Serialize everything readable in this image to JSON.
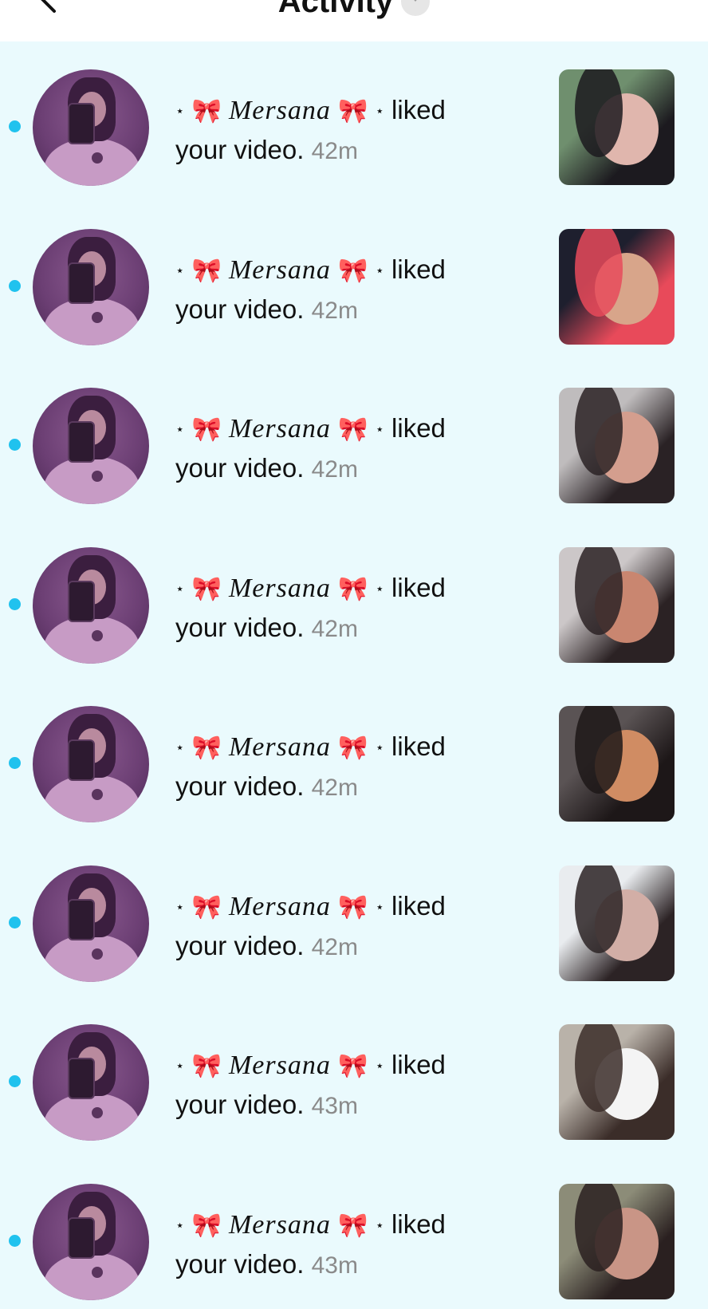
{
  "header": {
    "title": "Activity"
  },
  "colors": {
    "background": "#eafafd",
    "header": "#ffffff",
    "unread_dot": "#20c2ee",
    "timestamp": "#8a8a8a"
  },
  "notifications": [
    {
      "star_left": "⋆",
      "bow_left": "🎀",
      "username": "Mersana",
      "bow_right": "🎀",
      "star_right": "⋆",
      "action": "liked",
      "object": "your video.",
      "time": "42m",
      "unread": true,
      "thumb_colors": [
        "#6f8f6e",
        "#1c1a1f",
        "#e0b6ad"
      ]
    },
    {
      "star_left": "⋆",
      "bow_left": "🎀",
      "username": "Mersana",
      "bow_right": "🎀",
      "star_right": "⋆",
      "action": "liked",
      "object": "your video.",
      "time": "42m",
      "unread": true,
      "thumb_colors": [
        "#1e1f2e",
        "#e84a5a",
        "#d8a58a"
      ]
    },
    {
      "star_left": "⋆",
      "bow_left": "🎀",
      "username": "Mersana",
      "bow_right": "🎀",
      "star_right": "⋆",
      "action": "liked",
      "object": "your video.",
      "time": "42m",
      "unread": true,
      "thumb_colors": [
        "#bfbcbd",
        "#2a2225",
        "#d49e8e"
      ]
    },
    {
      "star_left": "⋆",
      "bow_left": "🎀",
      "username": "Mersana",
      "bow_right": "🎀",
      "star_right": "⋆",
      "action": "liked",
      "object": "your video.",
      "time": "42m",
      "unread": true,
      "thumb_colors": [
        "#ccc7c8",
        "#2b2224",
        "#c98670"
      ]
    },
    {
      "star_left": "⋆",
      "bow_left": "🎀",
      "username": "Mersana",
      "bow_right": "🎀",
      "star_right": "⋆",
      "action": "liked",
      "object": "your video.",
      "time": "42m",
      "unread": true,
      "thumb_colors": [
        "#5a5354",
        "#1d1718",
        "#d08c63"
      ]
    },
    {
      "star_left": "⋆",
      "bow_left": "🎀",
      "username": "Mersana",
      "bow_right": "🎀",
      "star_right": "⋆",
      "action": "liked",
      "object": "your video.",
      "time": "42m",
      "unread": true,
      "thumb_colors": [
        "#e9ecef",
        "#2c2325",
        "#d2aea6"
      ]
    },
    {
      "star_left": "⋆",
      "bow_left": "🎀",
      "username": "Mersana",
      "bow_right": "🎀",
      "star_right": "⋆",
      "action": "liked",
      "object": "your video.",
      "time": "43m",
      "unread": true,
      "thumb_colors": [
        "#b9b2a9",
        "#3b2d29",
        "#f4f4f4"
      ]
    },
    {
      "star_left": "⋆",
      "bow_left": "🎀",
      "username": "Mersana",
      "bow_right": "🎀",
      "star_right": "⋆",
      "action": "liked",
      "object": "your video.",
      "time": "43m",
      "unread": true,
      "thumb_colors": [
        "#8c8c78",
        "#2a2020",
        "#c99586"
      ]
    }
  ]
}
